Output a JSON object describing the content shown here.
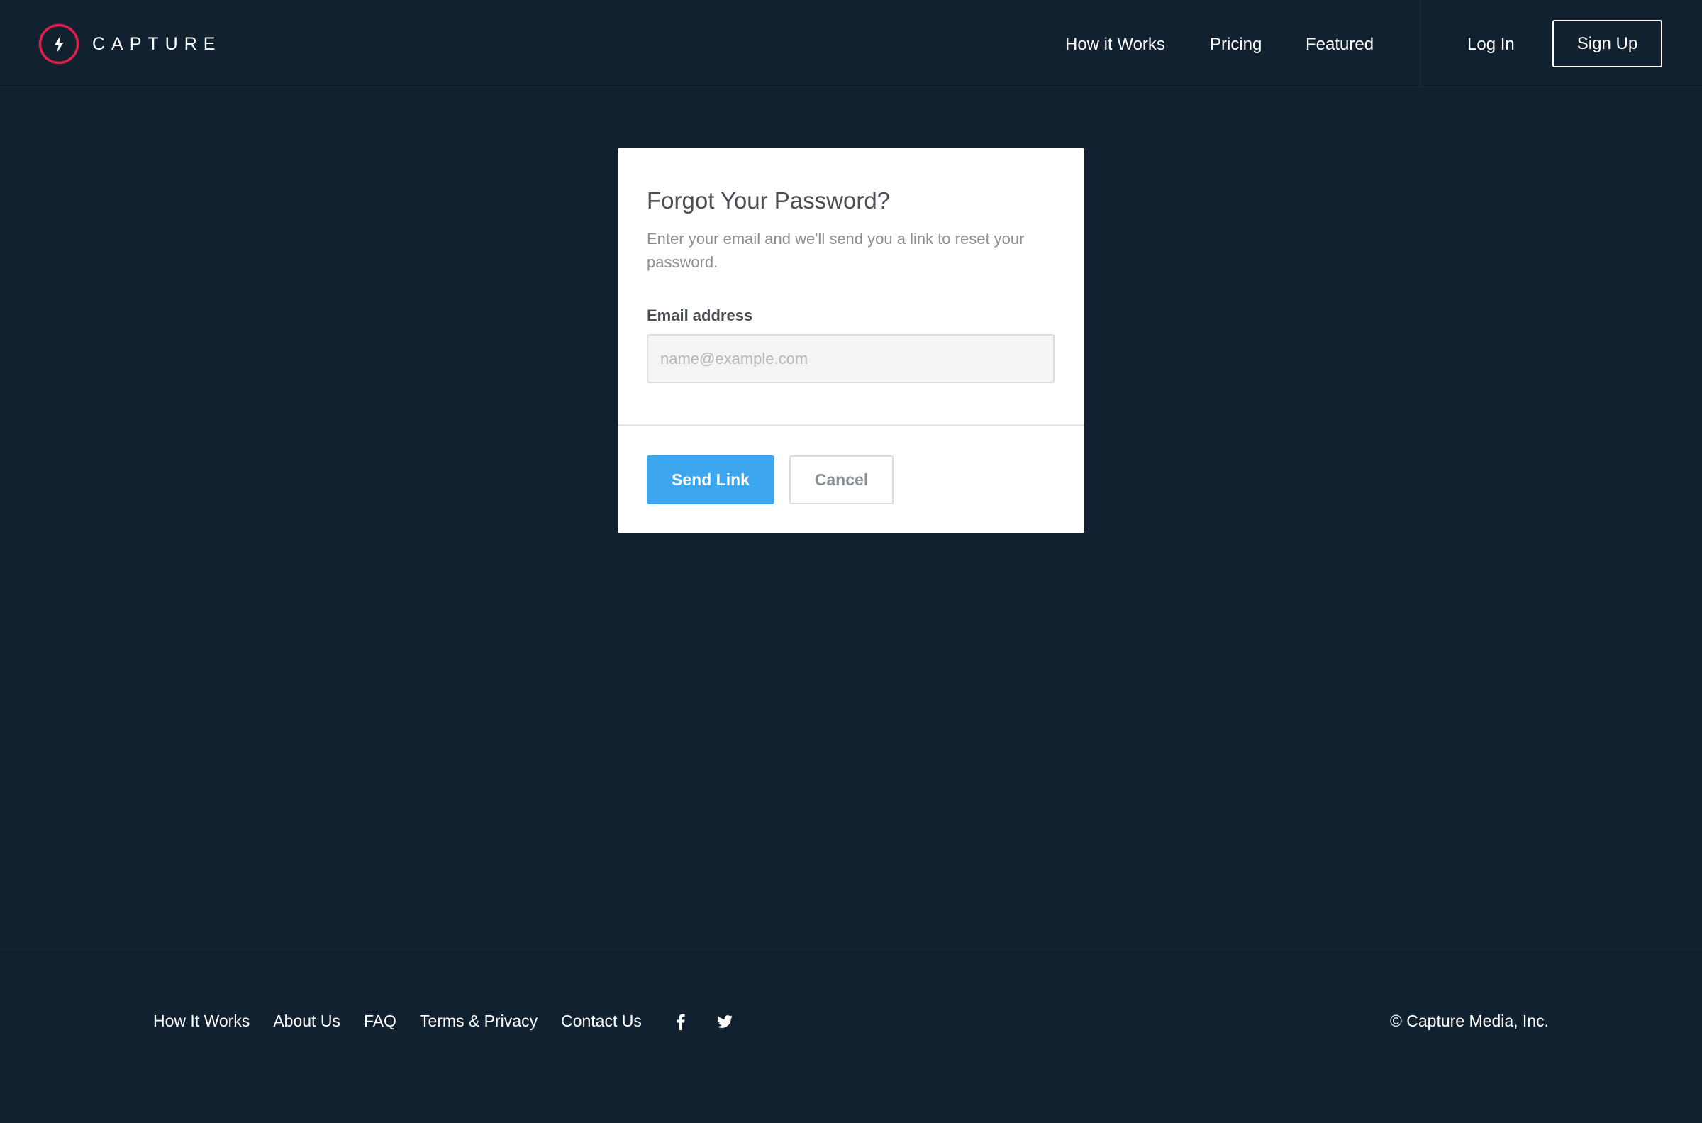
{
  "brand": {
    "name": "CAPTURE",
    "accent_color": "#e0204a",
    "logo_icon": "lightning-bolt-icon"
  },
  "nav": {
    "links": [
      {
        "label": "How it Works"
      },
      {
        "label": "Pricing"
      },
      {
        "label": "Featured"
      }
    ],
    "login_label": "Log In",
    "signup_label": "Sign Up"
  },
  "modal": {
    "title": "Forgot Your Password?",
    "description": "Enter your email and we'll send you a link to reset your password.",
    "email_label": "Email address",
    "email_placeholder": "name@example.com",
    "email_value": "",
    "send_label": "Send Link",
    "cancel_label": "Cancel",
    "primary_color": "#3ca6ee"
  },
  "footer": {
    "links": [
      {
        "label": "How It Works"
      },
      {
        "label": "About Us"
      },
      {
        "label": "FAQ"
      },
      {
        "label": "Terms & Privacy"
      },
      {
        "label": "Contact Us"
      }
    ],
    "social_icons": [
      "facebook-icon",
      "twitter-icon"
    ],
    "copyright": "© Capture Media, Inc."
  },
  "colors": {
    "background": "#112130",
    "text_light": "#ffffff"
  }
}
